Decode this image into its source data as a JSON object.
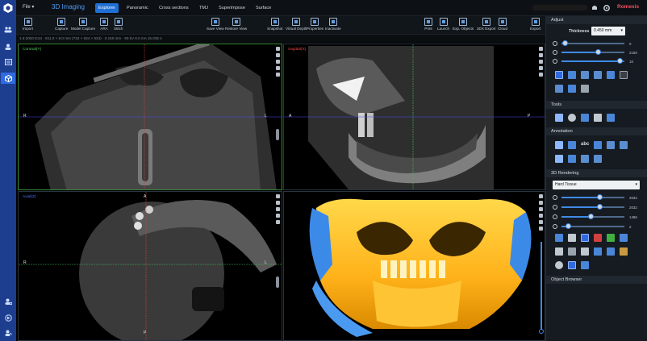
{
  "header": {
    "file_menu": "File",
    "app_title": "3D Imaging",
    "tabs": [
      {
        "label": "Explorer",
        "active": true
      },
      {
        "label": "Panoramic",
        "active": false
      },
      {
        "label": "Cross sections",
        "active": false
      },
      {
        "label": "TMJ",
        "active": false
      },
      {
        "label": "Superimpose",
        "active": false
      },
      {
        "label": "Surface",
        "active": false
      }
    ],
    "brand": "Romexis"
  },
  "toolbar": {
    "import": "Import",
    "capture": "Capture",
    "model_capture": "Model Capture",
    "ara": "ARA",
    "stitch": "Stitch",
    "save_view": "Save View",
    "restore_view": "Restore View",
    "snapshot": "Snapshot",
    "virtual_depth": "Virtual Depth",
    "properties": "Properties",
    "inactivate": "Inactivate",
    "print": "Print",
    "launch": "Launch",
    "exp_objects": "Exp. Objects",
    "export_3dx": "3DX Export",
    "cloud": "Cloud",
    "export": "Export"
  },
  "info_text": "1 8 2020 8:24 · 811.0 × 8.0 mm (734 × 634 × 634) · 0.150 mm · 90 kV 8.0 mA 15.035 s",
  "viewports": {
    "coronal": {
      "label": "Coronal(Y)",
      "left": "R",
      "right": "L",
      "color": "#55d060"
    },
    "sagittal": {
      "label": "Sagittal(X)",
      "left": "A",
      "right": "P",
      "color": "#f04848"
    },
    "axial": {
      "label": "Axial(Z)",
      "top": "A",
      "bottom": "P",
      "left": "R",
      "right": "L",
      "color": "#5070ff"
    }
  },
  "panel": {
    "adjust": {
      "title": "Adjust",
      "thickness_label": "Thickness",
      "thickness_value": "0.450 mm",
      "sliders": [
        {
          "name": "gamma",
          "value": "0",
          "level": 0.05
        },
        {
          "name": "brightness",
          "value": "2160",
          "level": 0.58
        },
        {
          "name": "contrast",
          "value": "10",
          "level": 0.92
        }
      ]
    },
    "tools": {
      "title": "Tools"
    },
    "annotation": {
      "title": "Annotation",
      "abc": "abc"
    },
    "rendering": {
      "title": "3D Rendering",
      "preset": "Hard Tissue",
      "sliders": [
        {
          "name": "opacity",
          "value": "2032",
          "level": 0.6
        },
        {
          "name": "brightness",
          "value": "2032",
          "level": 0.6
        },
        {
          "name": "threshold",
          "value": "1486",
          "level": 0.46
        },
        {
          "name": "contrast",
          "value": "2",
          "level": 0.1
        }
      ]
    },
    "object_browser": {
      "title": "Object Browser"
    }
  },
  "colors": {
    "accent": "#1f6fd6",
    "sidebar": "#1d3d8f",
    "brand": "#f05060"
  }
}
